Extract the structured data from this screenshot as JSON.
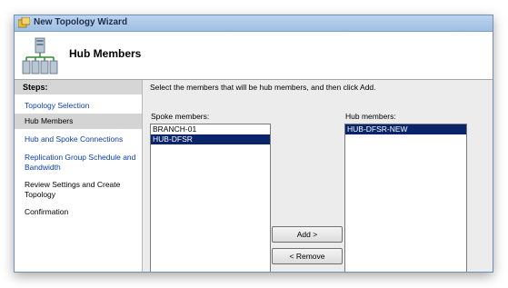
{
  "window": {
    "title": "New Topology Wizard"
  },
  "header": {
    "title": "Hub Members"
  },
  "sidebar": {
    "heading": "Steps:",
    "steps": [
      {
        "label": "Topology Selection",
        "state": "link"
      },
      {
        "label": "Hub Members",
        "state": "current"
      },
      {
        "label": "Hub and Spoke Connections",
        "state": "link"
      },
      {
        "label": "Replication Group Schedule and Bandwidth",
        "state": "link"
      },
      {
        "label": "Review Settings and Create Topology",
        "state": "plain"
      },
      {
        "label": "Confirmation",
        "state": "plain"
      }
    ]
  },
  "main": {
    "instruction": "Select the members that will be hub members, and then click Add.",
    "spoke": {
      "label": "Spoke members:",
      "items": [
        {
          "text": "BRANCH-01",
          "selected": false
        },
        {
          "text": "HUB-DFSR",
          "selected": true
        }
      ]
    },
    "hub": {
      "label": "Hub members:",
      "items": [
        {
          "text": "HUB-DFSR-NEW",
          "selected": true
        }
      ]
    },
    "add_label": "Add >",
    "remove_label": "< Remove"
  },
  "colors": {
    "titlebar": "#9fbfe3",
    "selection": "#0a246a",
    "link": "#0b3ea8",
    "panel": "#ececec"
  },
  "icons": [
    "topology-wizard-icon",
    "hub-topology-icon"
  ]
}
